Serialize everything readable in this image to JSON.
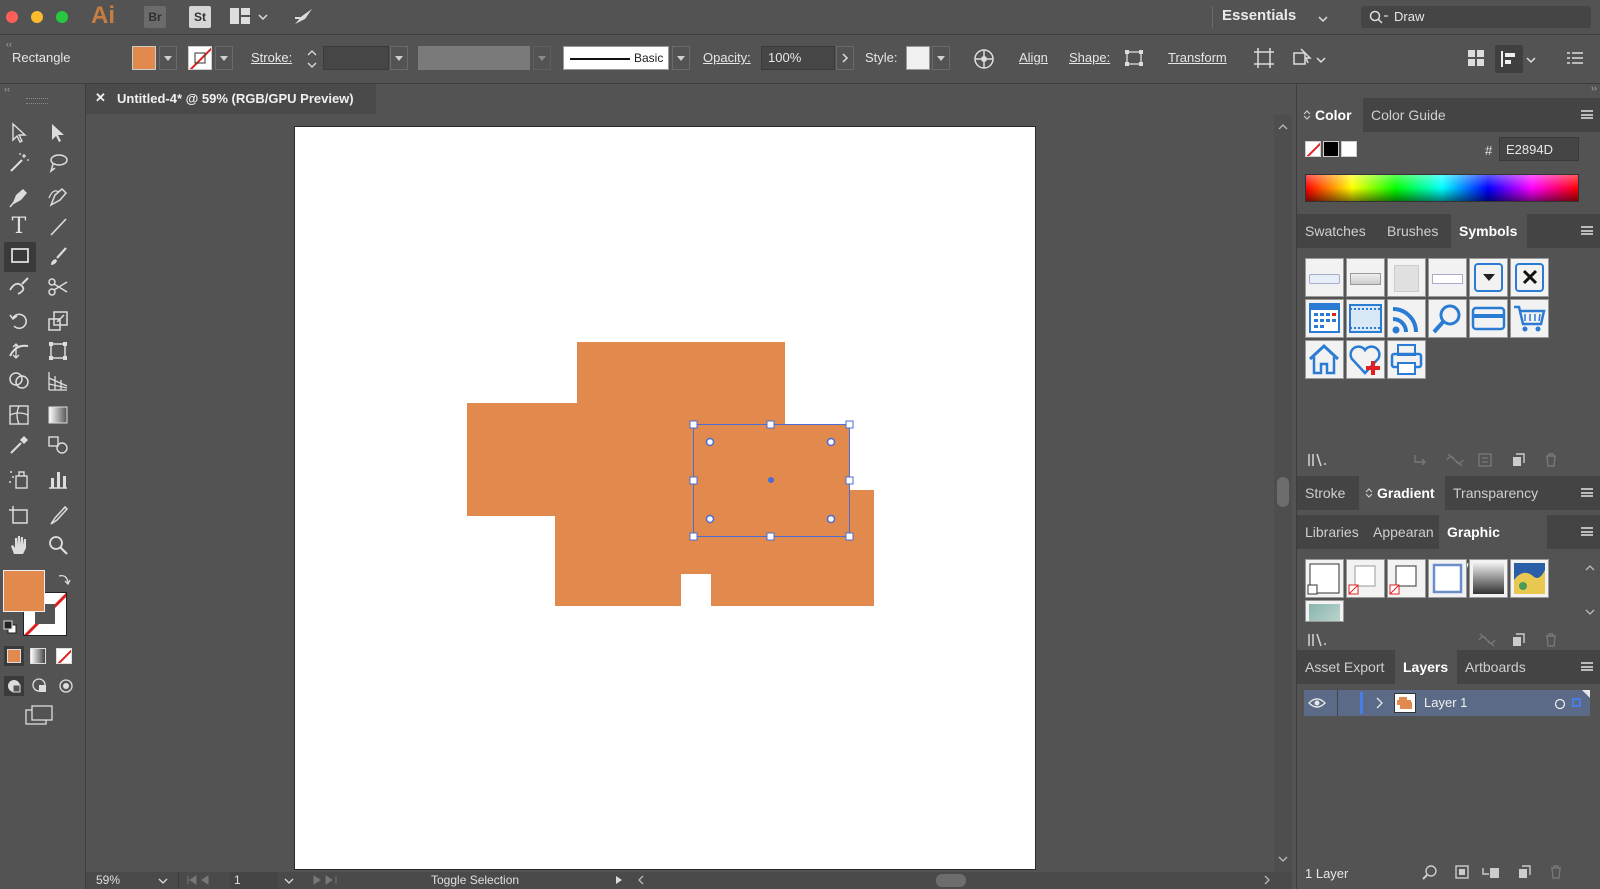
{
  "titlebar": {
    "app_logo": "Ai",
    "bridge_badge": "Br",
    "stock_badge": "St",
    "workspace": "Essentials",
    "search_value": "Draw"
  },
  "control_bar": {
    "tool_name": "Rectangle",
    "stroke_label": "Stroke:",
    "brush_label": "Basic",
    "opacity_label": "Opacity:",
    "opacity_value": "100%",
    "style_label": "Style:",
    "align_label": "Align",
    "shape_label": "Shape:",
    "transform_label": "Transform"
  },
  "document": {
    "tab_title": "Untitled-4* @ 59% (RGB/GPU Preview)"
  },
  "status_bar": {
    "zoom": "59%",
    "artboard_number": "1",
    "status_text": "Toggle Selection"
  },
  "panels": {
    "color_tabs": [
      "Color",
      "Color Guide"
    ],
    "hex_label": "#",
    "hex_value": "E2894D",
    "swatch_tabs": [
      "Swatches",
      "Brushes",
      "Symbols"
    ],
    "stroke_tabs": [
      "Stroke",
      "Gradient",
      "Transparency"
    ],
    "library_tabs": [
      "Libraries",
      "Appearan",
      "Graphic Styles"
    ],
    "layers_tabs": [
      "Asset Export",
      "Layers",
      "Artboards"
    ],
    "layer_name": "Layer 1",
    "layer_count": "1 Layer"
  },
  "colors": {
    "fill": "#E2894D",
    "selection": "#4a6cd4"
  }
}
